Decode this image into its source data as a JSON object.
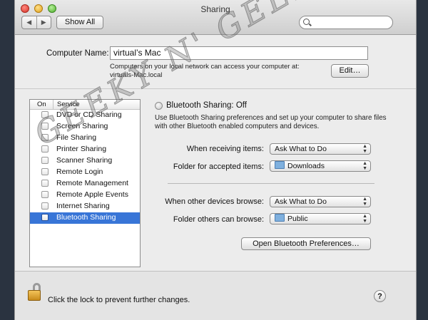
{
  "window": {
    "title": "Sharing"
  },
  "toolbar": {
    "back_glyph": "◀",
    "forward_glyph": "▶",
    "show_all_label": "Show All",
    "search_placeholder": ""
  },
  "computer": {
    "label": "Computer Name:",
    "value": "virtual’s Mac",
    "info_line1": "Computers on your local network can access your computer at:",
    "info_line2": "virtuals-Mac.local",
    "edit_label": "Edit…"
  },
  "services": {
    "header_on": "On",
    "header_service": "Service",
    "items": [
      {
        "label": "DVD or CD Sharing",
        "checked": false
      },
      {
        "label": "Screen Sharing",
        "checked": false
      },
      {
        "label": "File Sharing",
        "checked": false
      },
      {
        "label": "Printer Sharing",
        "checked": false
      },
      {
        "label": "Scanner Sharing",
        "checked": false
      },
      {
        "label": "Remote Login",
        "checked": false
      },
      {
        "label": "Remote Management",
        "checked": false
      },
      {
        "label": "Remote Apple Events",
        "checked": false
      },
      {
        "label": "Internet Sharing",
        "checked": false
      },
      {
        "label": "Bluetooth Sharing",
        "checked": false,
        "selected": true
      }
    ]
  },
  "detail": {
    "status": "Bluetooth Sharing: Off",
    "description": "Use Bluetooth Sharing preferences and set up your computer to share files with other Bluetooth enabled computers and devices.",
    "receiving_label": "When receiving items:",
    "receiving_value": "Ask What to Do",
    "accepted_label": "Folder for accepted items:",
    "accepted_value": "Downloads",
    "browse_label": "When other devices browse:",
    "browse_value": "Ask What to Do",
    "browse_folder_label": "Folder others can browse:",
    "browse_folder_value": "Public",
    "open_prefs_label": "Open Bluetooth Preferences…"
  },
  "footer": {
    "lock_text": "Click the lock to prevent further changes.",
    "help_glyph": "?"
  },
  "watermark": {
    "text": "GEEKY N' GEEK"
  },
  "colors": {
    "selection": "#3875d7",
    "background": "#2a3340"
  }
}
